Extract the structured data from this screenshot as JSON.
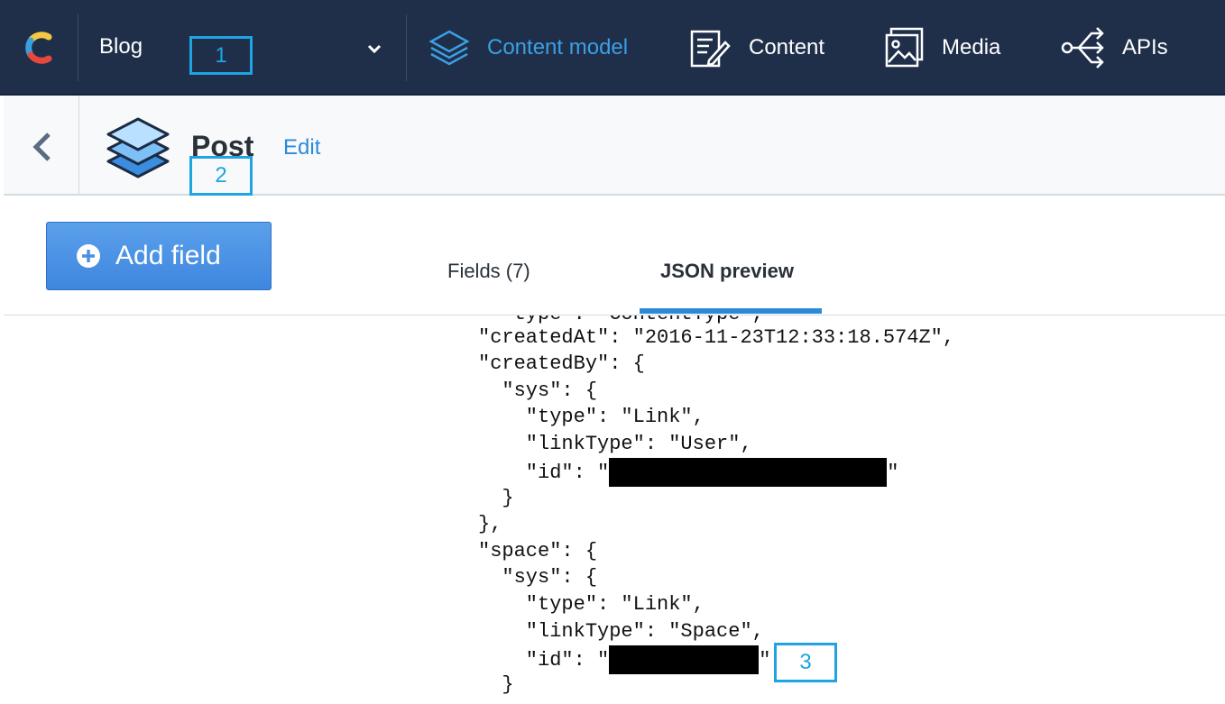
{
  "topnav": {
    "space_name": "Blog",
    "items": [
      {
        "label": "Content model",
        "icon": "layers-icon",
        "active": true
      },
      {
        "label": "Content",
        "icon": "content-edit-icon",
        "active": false
      },
      {
        "label": "Media",
        "icon": "media-image-icon",
        "active": false
      },
      {
        "label": "APIs",
        "icon": "api-share-icon",
        "active": false
      }
    ]
  },
  "annotations": [
    "1",
    "2",
    "3"
  ],
  "header": {
    "title": "Post",
    "edit_label": "Edit"
  },
  "toolbar": {
    "add_field_label": "Add field"
  },
  "tabs": [
    {
      "label": "Fields (7)",
      "active": false
    },
    {
      "label": "JSON preview",
      "active": true
    }
  ],
  "json_preview": {
    "lines": [
      "  \"type\": \"ContentType\",",
      "\"createdAt\": \"2016-11-23T12:33:18.574Z\",",
      "\"createdBy\": {",
      "  \"sys\": {",
      "    \"type\": \"Link\",",
      "    \"linkType\": \"User\",",
      "    \"id\": \"",
      "  }",
      "},",
      "\"space\": {",
      "  \"sys\": {",
      "    \"type\": \"Link\",",
      "    \"linkType\": \"Space\",",
      "    \"id\": \"",
      "  }"
    ],
    "quote_char": "\""
  },
  "colors": {
    "nav_bg": "#1f2f4a",
    "accent": "#2d8ad9",
    "annotation": "#1fa3e3",
    "button": "#4a90e2"
  }
}
